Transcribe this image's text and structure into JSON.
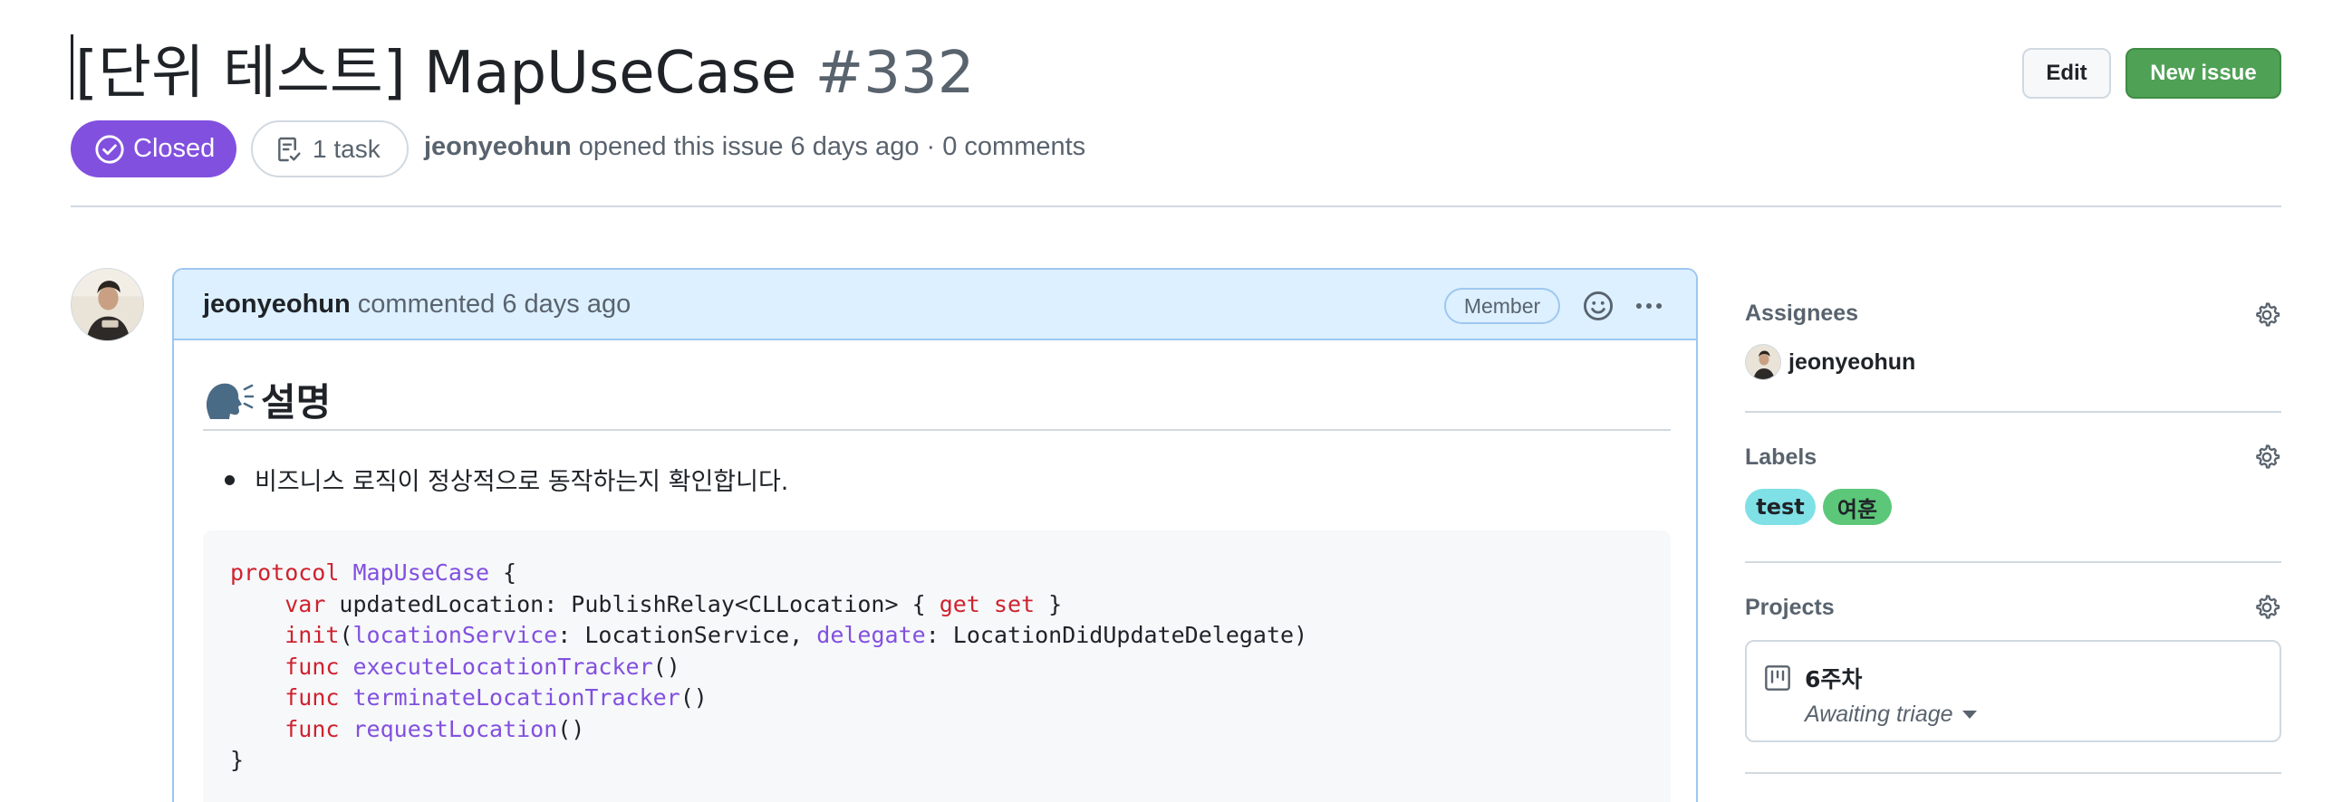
{
  "issue": {
    "title": "[단위 테스트] MapUseCase",
    "number": "#332",
    "state": "Closed",
    "task_count": "1 task",
    "author": "jeonyeohun",
    "meta_text": " opened this issue 6 days ago · 0 comments"
  },
  "header_actions": {
    "edit_label": "Edit",
    "new_issue_label": "New issue"
  },
  "comment": {
    "author": "jeonyeohun",
    "time_text": " commented 6 days ago",
    "role_badge": "Member",
    "heading": "설명",
    "bullet": "비즈니스 로직이 정상적으로 동작하는지 확인합니다.",
    "code_lines": [
      [
        {
          "t": "protocol",
          "c": "kw"
        },
        {
          "t": " "
        },
        {
          "t": "MapUseCase",
          "c": "ty"
        },
        {
          "t": " {"
        }
      ],
      [
        {
          "t": "    "
        },
        {
          "t": "var",
          "c": "kw"
        },
        {
          "t": " updatedLocation: PublishRelay<CLLocation> { "
        },
        {
          "t": "get",
          "c": "kw"
        },
        {
          "t": " "
        },
        {
          "t": "set",
          "c": "kw"
        },
        {
          "t": " }"
        }
      ],
      [
        {
          "t": "    "
        },
        {
          "t": "init",
          "c": "kw"
        },
        {
          "t": "("
        },
        {
          "t": "locationService",
          "c": "pm"
        },
        {
          "t": ": LocationService, "
        },
        {
          "t": "delegate",
          "c": "pm"
        },
        {
          "t": ": LocationDidUpdateDelegate)"
        }
      ],
      [
        {
          "t": "    "
        },
        {
          "t": "func",
          "c": "kw"
        },
        {
          "t": " "
        },
        {
          "t": "executeLocationTracker",
          "c": "fn"
        },
        {
          "t": "()"
        }
      ],
      [
        {
          "t": "    "
        },
        {
          "t": "func",
          "c": "kw"
        },
        {
          "t": " "
        },
        {
          "t": "terminateLocationTracker",
          "c": "fn"
        },
        {
          "t": "()"
        }
      ],
      [
        {
          "t": "    "
        },
        {
          "t": "func",
          "c": "kw"
        },
        {
          "t": " "
        },
        {
          "t": "requestLocation",
          "c": "fn"
        },
        {
          "t": "()"
        }
      ],
      [
        {
          "t": "}"
        }
      ]
    ]
  },
  "sidebar": {
    "assignees": {
      "title": "Assignees",
      "users": [
        "jeonyeohun"
      ]
    },
    "labels": {
      "title": "Labels",
      "items": [
        {
          "name": "test",
          "color": "#7fe0e6"
        },
        {
          "name": "여훈",
          "color": "#5cc779"
        }
      ]
    },
    "projects": {
      "title": "Projects",
      "project_name": "6주차",
      "status": "Awaiting triage"
    }
  },
  "colors": {
    "closed": "#8250df",
    "primary_button": "#4fa155",
    "comment_header": "#ddf0ff"
  }
}
